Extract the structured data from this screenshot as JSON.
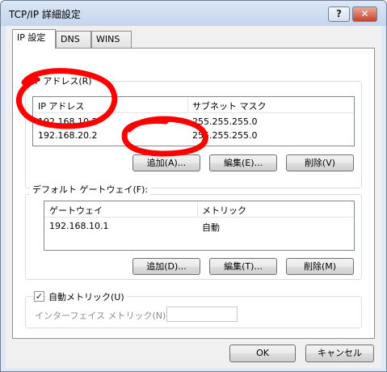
{
  "window": {
    "title": "TCP/IP 詳細設定",
    "help_label": "?",
    "close_label": "✕"
  },
  "tabs": [
    {
      "label": "IP 設定"
    },
    {
      "label": "DNS"
    },
    {
      "label": "WINS"
    }
  ],
  "ip_group": {
    "label": "IP アドレス(R)",
    "columns": [
      "IP アドレス",
      "サブネット マスク"
    ],
    "rows": [
      {
        "ip": "192.168.10.2",
        "mask": "255.255.255.0"
      },
      {
        "ip": "192.168.20.2",
        "mask": "255.255.255.0"
      }
    ],
    "buttons": {
      "add": "追加(A)...",
      "edit": "編集(E)...",
      "delete": "削除(V)"
    }
  },
  "gateway_group": {
    "label": "デフォルト ゲートウェイ(F):",
    "columns": [
      "ゲートウェイ",
      "メトリック"
    ],
    "rows": [
      {
        "gateway": "192.168.10.1",
        "metric": "自動"
      }
    ],
    "buttons": {
      "add": "追加(D)...",
      "edit": "編集(T)...",
      "delete": "削除(M)"
    }
  },
  "metric_group": {
    "auto_metric_label": "自動メトリック(U)",
    "auto_metric_checked": true,
    "check_glyph": "✓",
    "interface_metric_label": "インターフェイス メトリック(N):",
    "interface_metric_value": ""
  },
  "footer": {
    "ok_label": "OK",
    "cancel_label": "キャンセル"
  },
  "annotation": {
    "color": "#ff0000"
  }
}
